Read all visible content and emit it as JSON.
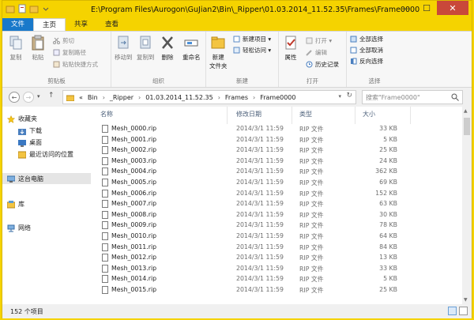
{
  "window": {
    "title": "E:\\Program Files\\Aurogon\\GuJian2\\Bin\\_Ripper\\01.03.2014_11.52.35\\Frames\\Frame0000",
    "controls": {
      "minimize": "—",
      "maximize": "☐",
      "close": "✕"
    }
  },
  "tabs": [
    "文件",
    "主页",
    "共享",
    "查看"
  ],
  "ribbon": {
    "clipboard": {
      "copy": "复制",
      "paste": "粘贴",
      "cut": "剪切",
      "copy_path": "复制路径",
      "paste_shortcut": "粘贴快捷方式",
      "label": "剪贴板"
    },
    "organize": {
      "move_to": "移动到",
      "copy_to": "复制到",
      "delete": "删除",
      "rename": "重命名",
      "label": "组织"
    },
    "new": {
      "new_folder": "新建\n文件夹",
      "new_item": "新建项目 ▾",
      "easy_access": "轻松访问 ▾",
      "label": "新建"
    },
    "open": {
      "properties": "属性",
      "open": "打开 ▾",
      "edit": "编辑",
      "history": "历史记录",
      "label": "打开"
    },
    "select": {
      "select_all": "全部选择",
      "select_none": "全部取消",
      "invert": "反向选择",
      "label": "选择"
    }
  },
  "address": {
    "breadcrumbs": [
      "«",
      "Bin",
      "›",
      "_Ripper",
      "›",
      "01.03.2014_11.52.35",
      "›",
      "Frames",
      "›",
      "Frame0000"
    ],
    "search_placeholder": "搜索\"Frame0000\""
  },
  "nav_pane": {
    "favorites": "收藏夹",
    "items": [
      "下载",
      "桌面",
      "最近访问的位置"
    ],
    "this_pc": "这台电脑",
    "libraries": "库",
    "network": "网络"
  },
  "columns": {
    "name": "名称",
    "date": "修改日期",
    "type": "类型",
    "size": "大小"
  },
  "files": [
    {
      "name": "Mesh_0000.rip",
      "date": "2014/3/1 11:59",
      "type": "RIP 文件",
      "size": "33 KB"
    },
    {
      "name": "Mesh_0001.rip",
      "date": "2014/3/1 11:59",
      "type": "RIP 文件",
      "size": "5 KB"
    },
    {
      "name": "Mesh_0002.rip",
      "date": "2014/3/1 11:59",
      "type": "RIP 文件",
      "size": "25 KB"
    },
    {
      "name": "Mesh_0003.rip",
      "date": "2014/3/1 11:59",
      "type": "RIP 文件",
      "size": "24 KB"
    },
    {
      "name": "Mesh_0004.rip",
      "date": "2014/3/1 11:59",
      "type": "RIP 文件",
      "size": "362 KB"
    },
    {
      "name": "Mesh_0005.rip",
      "date": "2014/3/1 11:59",
      "type": "RIP 文件",
      "size": "69 KB"
    },
    {
      "name": "Mesh_0006.rip",
      "date": "2014/3/1 11:59",
      "type": "RIP 文件",
      "size": "152 KB"
    },
    {
      "name": "Mesh_0007.rip",
      "date": "2014/3/1 11:59",
      "type": "RIP 文件",
      "size": "63 KB"
    },
    {
      "name": "Mesh_0008.rip",
      "date": "2014/3/1 11:59",
      "type": "RIP 文件",
      "size": "30 KB"
    },
    {
      "name": "Mesh_0009.rip",
      "date": "2014/3/1 11:59",
      "type": "RIP 文件",
      "size": "78 KB"
    },
    {
      "name": "Mesh_0010.rip",
      "date": "2014/3/1 11:59",
      "type": "RIP 文件",
      "size": "64 KB"
    },
    {
      "name": "Mesh_0011.rip",
      "date": "2014/3/1 11:59",
      "type": "RIP 文件",
      "size": "84 KB"
    },
    {
      "name": "Mesh_0012.rip",
      "date": "2014/3/1 11:59",
      "type": "RIP 文件",
      "size": "13 KB"
    },
    {
      "name": "Mesh_0013.rip",
      "date": "2014/3/1 11:59",
      "type": "RIP 文件",
      "size": "33 KB"
    },
    {
      "name": "Mesh_0014.rip",
      "date": "2014/3/1 11:59",
      "type": "RIP 文件",
      "size": "5 KB"
    },
    {
      "name": "Mesh_0015.rip",
      "date": "2014/3/1 11:59",
      "type": "RIP 文件",
      "size": "25 KB"
    }
  ],
  "status": {
    "count": "152 个项目"
  },
  "colors": {
    "title_bar": "#f5d300",
    "file_tab": "#1979ca",
    "close_button": "#c9483a"
  }
}
